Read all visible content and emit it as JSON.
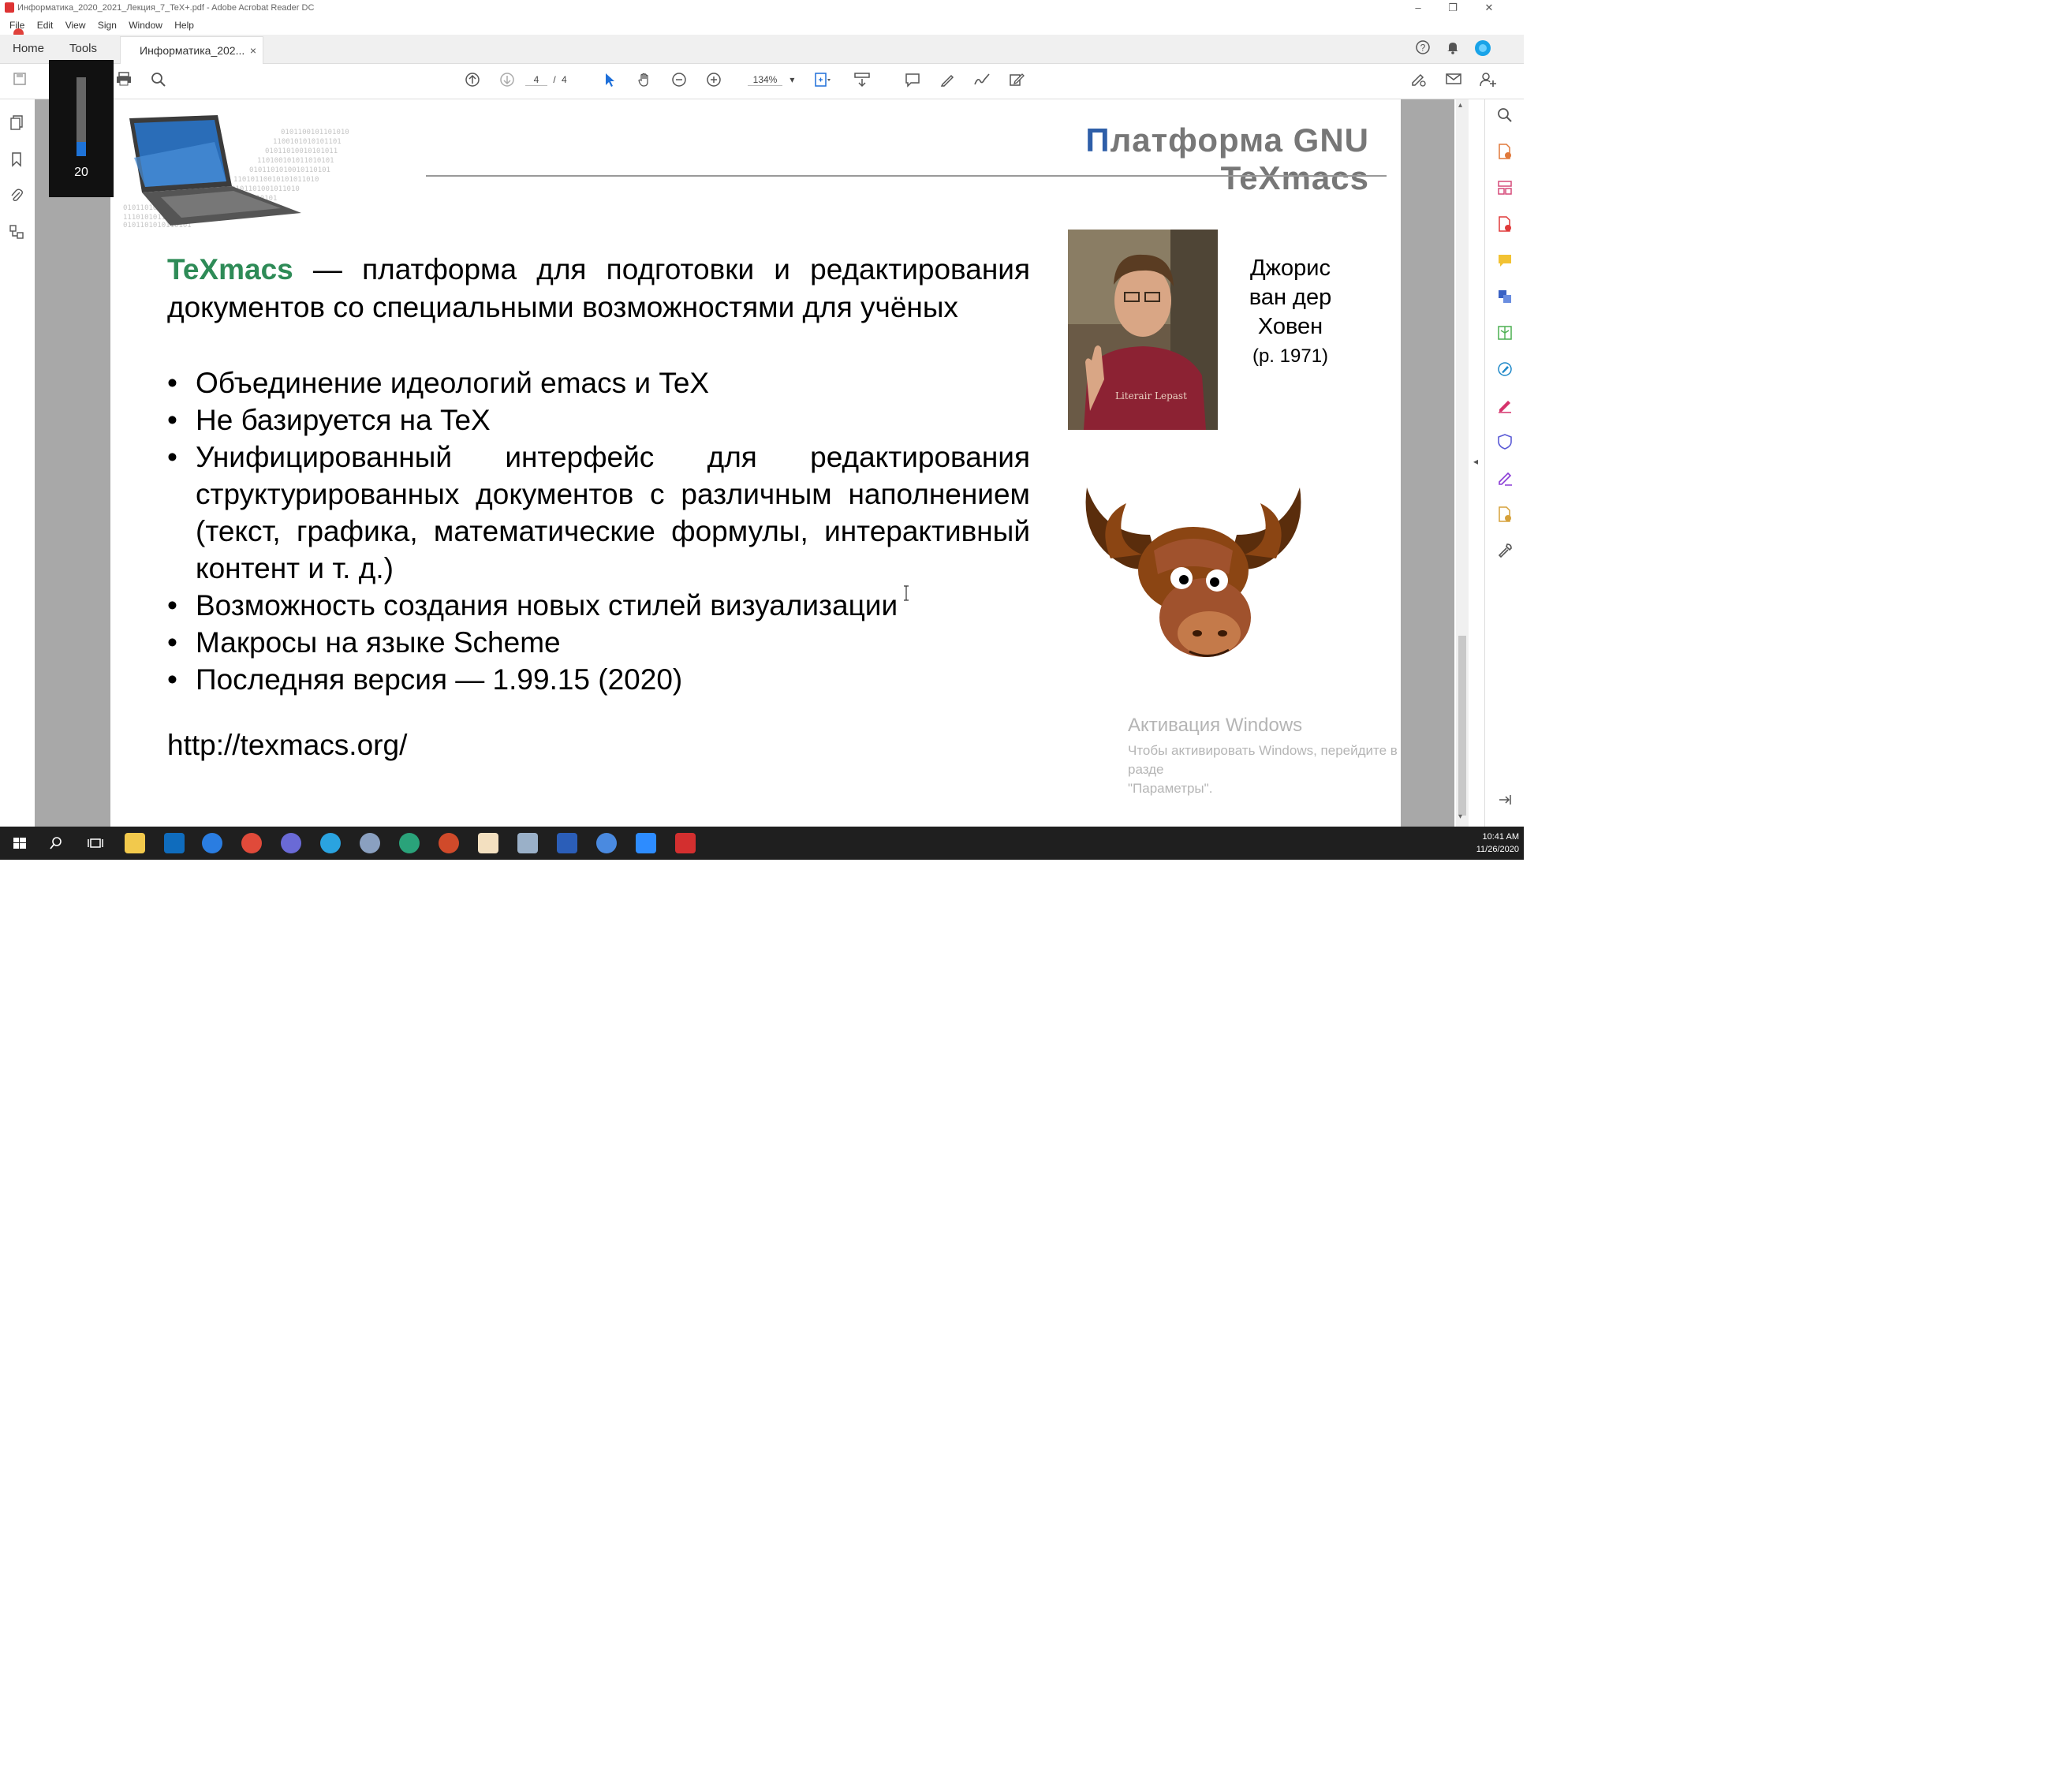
{
  "window": {
    "title": "Информатика_2020_2021_Лекция_7_TeX+.pdf - Adobe Acrobat Reader DC",
    "controls": {
      "minimize": "–",
      "restore": "❐",
      "close": "✕"
    }
  },
  "menu": [
    "File",
    "Edit",
    "View",
    "Sign",
    "Window",
    "Help"
  ],
  "nav_tabs": {
    "home": "Home",
    "tools": "Tools"
  },
  "doc_tab": {
    "label": "Информатика_202...",
    "close": "×"
  },
  "toolbar": {
    "page_current": "4",
    "page_separator": "/",
    "page_total": "4",
    "zoom": "134%"
  },
  "volume_overlay": {
    "level": 20
  },
  "slide": {
    "title_first": "П",
    "title_rest": "латформа GNU TeXmacs",
    "intro_highlight": "TeXmacs",
    "intro_rest": " — платформа для подготовки и редактирования документов со специальными возможностями для учёных",
    "bullets": [
      "Объединение идеологий emacs и TeX",
      "Не базируется на TeX",
      "Унифицированный интерфейс для редактирования структурированных документов с различным наполнением (текст, графика, математические формулы, интерактивный контент и т. д.)",
      "Возможность создания новых стилей визуализации",
      "Макросы на языке Scheme",
      "Последняя версия — 1.99.15 (2020)"
    ],
    "url": "http://texmacs.org/",
    "person_line1": "Джорис",
    "person_line2": "ван дер",
    "person_line3": "Ховен",
    "person_year": "(р. 1971)",
    "photo_shirt_text": "Literair Lepast"
  },
  "watermark": {
    "line1": "Активация Windows",
    "line2": "Чтобы активировать Windows, перейдите в разде",
    "line3": "\"Параметры\"."
  },
  "taskbar": {
    "time": "10:41 AM",
    "date": "11/26/2020"
  },
  "colors": {
    "title_accent": "#2e5ea8",
    "texmacs_green": "#2e8b57",
    "acrobat_red": "#e0413b",
    "taskbar": "#1f1f1f"
  },
  "icons": {
    "toolbar": [
      "save-icon",
      "print-icon",
      "search-zoom-icon",
      "page-up-icon",
      "page-down-icon",
      "select-cursor-icon",
      "hand-icon",
      "zoom-out-icon",
      "zoom-in-icon",
      "fit-page-icon",
      "scroll-mode-icon",
      "comment-icon",
      "pen-icon",
      "sign-icon",
      "edit-icon",
      "share-link-icon",
      "mail-icon",
      "add-user-icon"
    ],
    "right_rail": [
      "search-icon",
      "export-pdf-icon",
      "organize-pages-icon",
      "create-pdf-icon",
      "comment-icon",
      "combine-files-icon",
      "compress-icon",
      "edit-pdf-icon",
      "fill-sign-icon",
      "protect-icon",
      "sign-icon",
      "more-tools-icon",
      "wrench-icon"
    ]
  }
}
